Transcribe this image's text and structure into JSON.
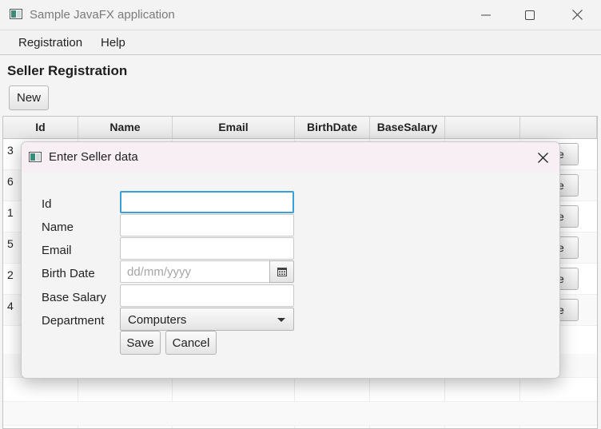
{
  "window": {
    "title": "Sample JavaFX application"
  },
  "menu": {
    "items": [
      "Registration",
      "Help"
    ]
  },
  "page": {
    "heading": "Seller Registration",
    "new_label": "New"
  },
  "table": {
    "columns": [
      "Id",
      "Name",
      "Email",
      "BirthDate",
      "BaseSalary",
      "",
      ""
    ],
    "rows": [
      {
        "id": "3",
        "action": "ve"
      },
      {
        "id": "6",
        "action": "ve"
      },
      {
        "id": "1",
        "action": "ve"
      },
      {
        "id": "5",
        "action": "ve"
      },
      {
        "id": "2",
        "action": "ve"
      },
      {
        "id": "4",
        "action": "ve"
      }
    ]
  },
  "dialog": {
    "title": "Enter Seller data",
    "labels": {
      "id": "Id",
      "name": "Name",
      "email": "Email",
      "birth_date": "Birth Date",
      "base_salary": "Base Salary",
      "department": "Department"
    },
    "values": {
      "id": "",
      "name": "",
      "email": "",
      "birth_date": "",
      "base_salary": ""
    },
    "birth_date_placeholder": "dd/mm/yyyy",
    "department_selected": "Computers",
    "save_label": "Save",
    "cancel_label": "Cancel"
  },
  "icons": {
    "app": "javafx-app-icon",
    "calendar": "calendar-icon",
    "close": "close-icon"
  },
  "colors": {
    "focus": "#3aa0d8",
    "dialog_title_bg": "#f8eff4"
  }
}
